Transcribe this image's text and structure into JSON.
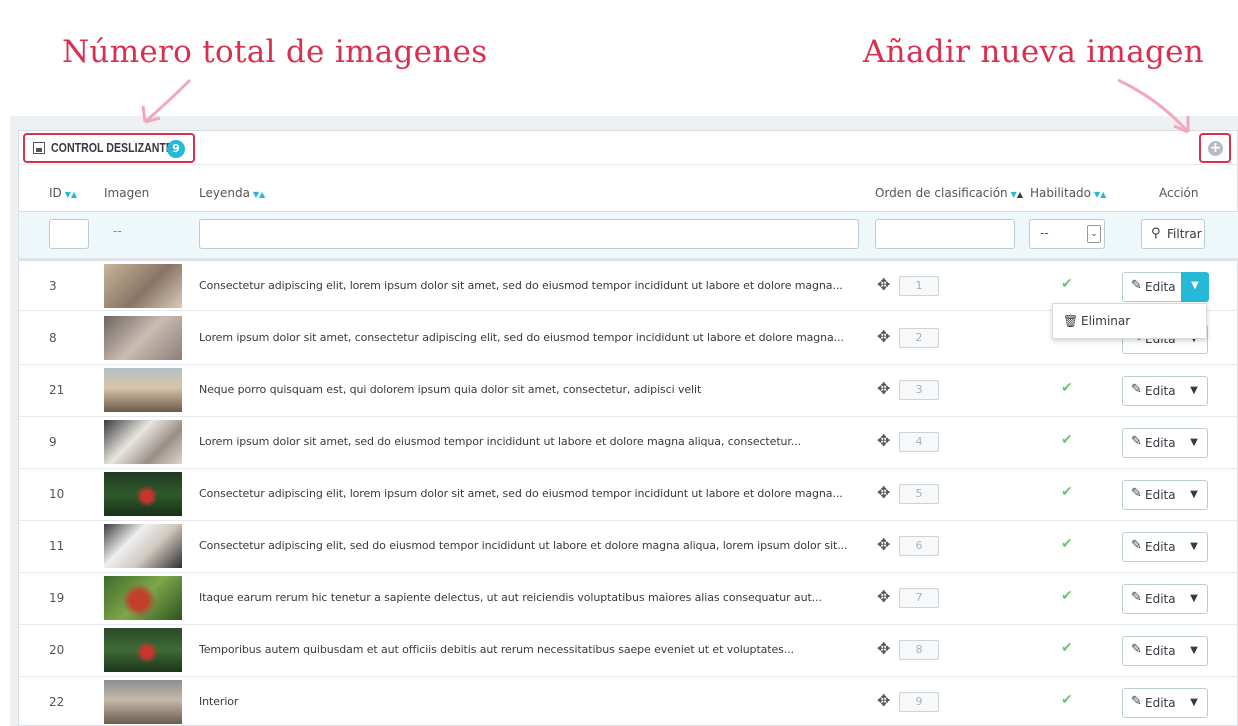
{
  "annotations": {
    "left": "Número total de imagenes",
    "right": "Añadir nueva imagen"
  },
  "panel": {
    "title": "CONTROL DESLIZANTE",
    "count": "9",
    "add_icon": "plus-circle-icon"
  },
  "columns": {
    "id": "ID",
    "image": "Imagen",
    "caption": "Leyenda",
    "sort_order": "Orden de clasificación",
    "enabled": "Habilitado",
    "action": "Acción"
  },
  "filters": {
    "image_placeholder": "--",
    "enabled_value": "--",
    "filter_button": "Filtrar"
  },
  "rows": [
    {
      "id": "3",
      "caption": "Consectetur adipiscing elit, lorem ipsum dolor sit amet, sed do eiusmod tempor incididunt ut labore et dolore magna...",
      "position": "1",
      "edit": "Edita"
    },
    {
      "id": "8",
      "caption": "Lorem ipsum dolor sit amet, consectetur adipiscing elit, sed do eiusmod tempor incididunt ut labore et dolore magna...",
      "position": "2",
      "edit": "Edita"
    },
    {
      "id": "21",
      "caption": "Neque porro quisquam est, qui dolorem ipsum quia dolor sit amet, consectetur, adipisci velit",
      "position": "3",
      "edit": "Edita"
    },
    {
      "id": "9",
      "caption": "Lorem ipsum dolor sit amet, sed do eiusmod tempor incididunt ut labore et dolore magna aliqua, consectetur...",
      "position": "4",
      "edit": "Edita"
    },
    {
      "id": "10",
      "caption": "Consectetur adipiscing elit, lorem ipsum dolor sit amet, sed do eiusmod tempor incididunt ut labore et dolore magna...",
      "position": "5",
      "edit": "Edita"
    },
    {
      "id": "11",
      "caption": "Consectetur adipiscing elit, sed do eiusmod tempor incididunt ut labore et dolore magna aliqua, lorem ipsum dolor sit...",
      "position": "6",
      "edit": "Edita"
    },
    {
      "id": "19",
      "caption": "Itaque earum rerum hic tenetur a sapiente delectus, ut aut reiciendis voluptatibus maiores alias consequatur aut...",
      "position": "7",
      "edit": "Edita"
    },
    {
      "id": "20",
      "caption": "Temporibus autem quibusdam et aut officiis debitis aut rerum necessitatibus saepe eveniet ut et voluptates...",
      "position": "8",
      "edit": "Edita"
    },
    {
      "id": "22",
      "caption": "Interior",
      "position": "9",
      "edit": "Edita"
    }
  ],
  "dropdown": {
    "delete_label": "Eliminar"
  },
  "colors": {
    "accent": "#25b9d7",
    "annotation": "#d9304f",
    "enabled_check": "#72c279"
  }
}
